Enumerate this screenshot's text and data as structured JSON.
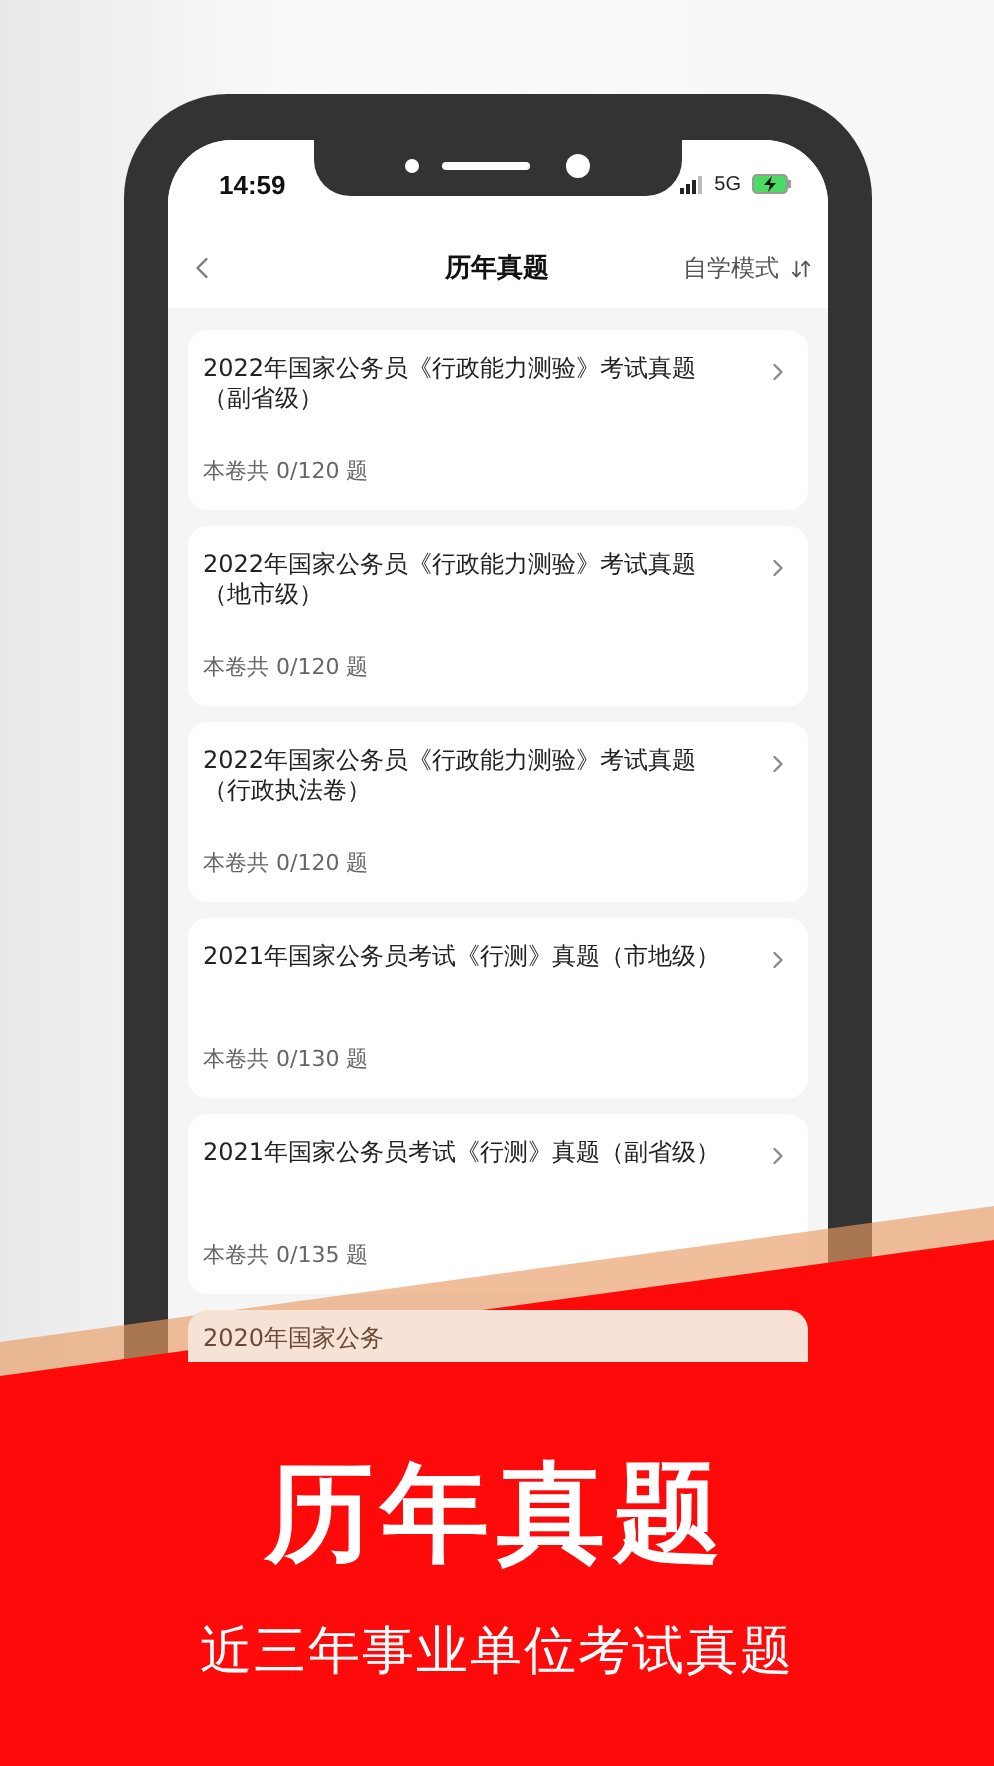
{
  "status_bar": {
    "time": "14:59",
    "network": "5G"
  },
  "header": {
    "title": "历年真题",
    "mode": "自学模式"
  },
  "papers": [
    {
      "title": "2022年国家公务员《行政能力测验》考试真题（副省级）",
      "count": "本卷共 0/120 题"
    },
    {
      "title": "2022年国家公务员《行政能力测验》考试真题（地市级）",
      "count": "本卷共 0/120 题"
    },
    {
      "title": "2022年国家公务员《行政能力测验》考试真题（行政执法卷）",
      "count": "本卷共 0/120 题"
    },
    {
      "title": "2021年国家公务员考试《行测》真题（市地级）",
      "count": "本卷共 0/130 题"
    },
    {
      "title": "2021年国家公务员考试《行测》真题（副省级）",
      "count": "本卷共 0/135 题"
    },
    {
      "title": "2020年国家公务"
    }
  ],
  "banner": {
    "title": "历年真题",
    "subtitle": "近三年事业单位考试真题"
  }
}
